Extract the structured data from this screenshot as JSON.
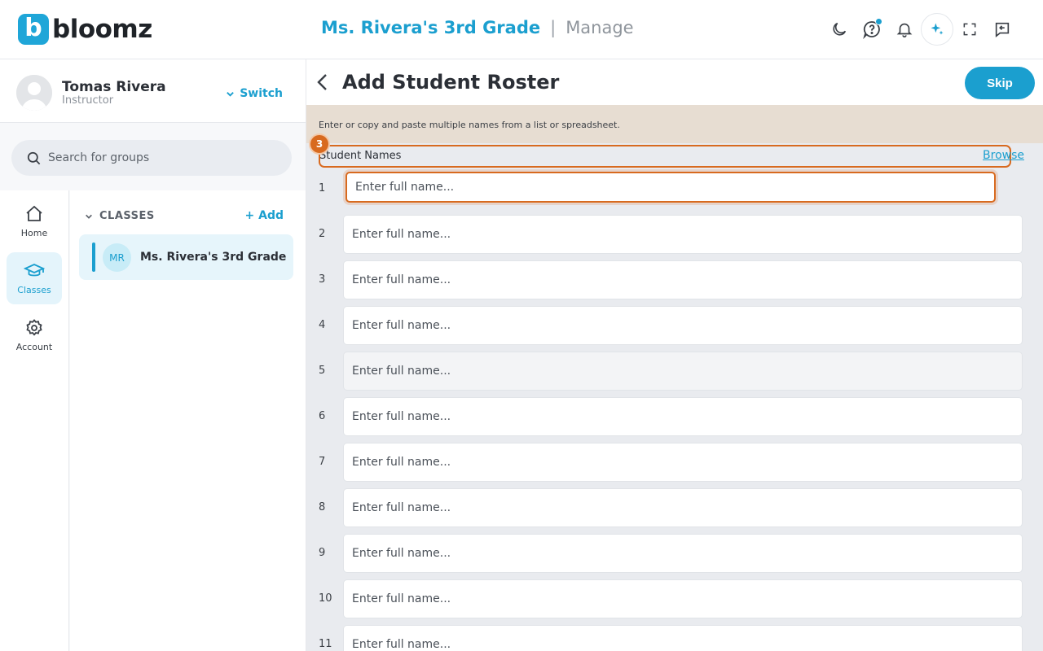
{
  "header": {
    "logo_letter": "b",
    "logo_text": "bloomz",
    "group_title": "Ms. Rivera's 3rd Grade",
    "separator": "|",
    "section": "Manage",
    "notification_dot_color": "#1b9fcf"
  },
  "profile": {
    "name": "Tomas Rivera",
    "role": "Instructor",
    "switch_label": "Switch"
  },
  "search": {
    "placeholder": "Search for groups"
  },
  "rail": {
    "items": [
      {
        "label": "Home",
        "icon": "home-icon"
      },
      {
        "label": "Classes",
        "icon": "graduation-cap-icon",
        "active": true
      },
      {
        "label": "Account",
        "icon": "gear-icon"
      }
    ]
  },
  "classes": {
    "heading": "CLASSES",
    "add_label": "+ Add",
    "items": [
      {
        "initials": "MR",
        "name": "Ms. Rivera's 3rd Grade"
      }
    ]
  },
  "main": {
    "title": "Add Student Roster",
    "skip_label": "Skip",
    "instructions": "Enter or copy and paste multiple names from a list or spreadsheet.",
    "names_heading": "Student Names",
    "browse_label": "Browse",
    "step_number": "3",
    "accent_color": "#1b9fcf",
    "highlight_color": "#d86a1f",
    "rows": [
      {
        "num": "1",
        "placeholder": "Enter full name..."
      },
      {
        "num": "2",
        "placeholder": "Enter full name..."
      },
      {
        "num": "3",
        "placeholder": "Enter full name..."
      },
      {
        "num": "4",
        "placeholder": "Enter full name..."
      },
      {
        "num": "5",
        "placeholder": "Enter full name..."
      },
      {
        "num": "6",
        "placeholder": "Enter full name..."
      },
      {
        "num": "7",
        "placeholder": "Enter full name..."
      },
      {
        "num": "8",
        "placeholder": "Enter full name..."
      },
      {
        "num": "9",
        "placeholder": "Enter full name..."
      },
      {
        "num": "10",
        "placeholder": "Enter full name..."
      },
      {
        "num": "11",
        "placeholder": "Enter full name..."
      }
    ]
  }
}
